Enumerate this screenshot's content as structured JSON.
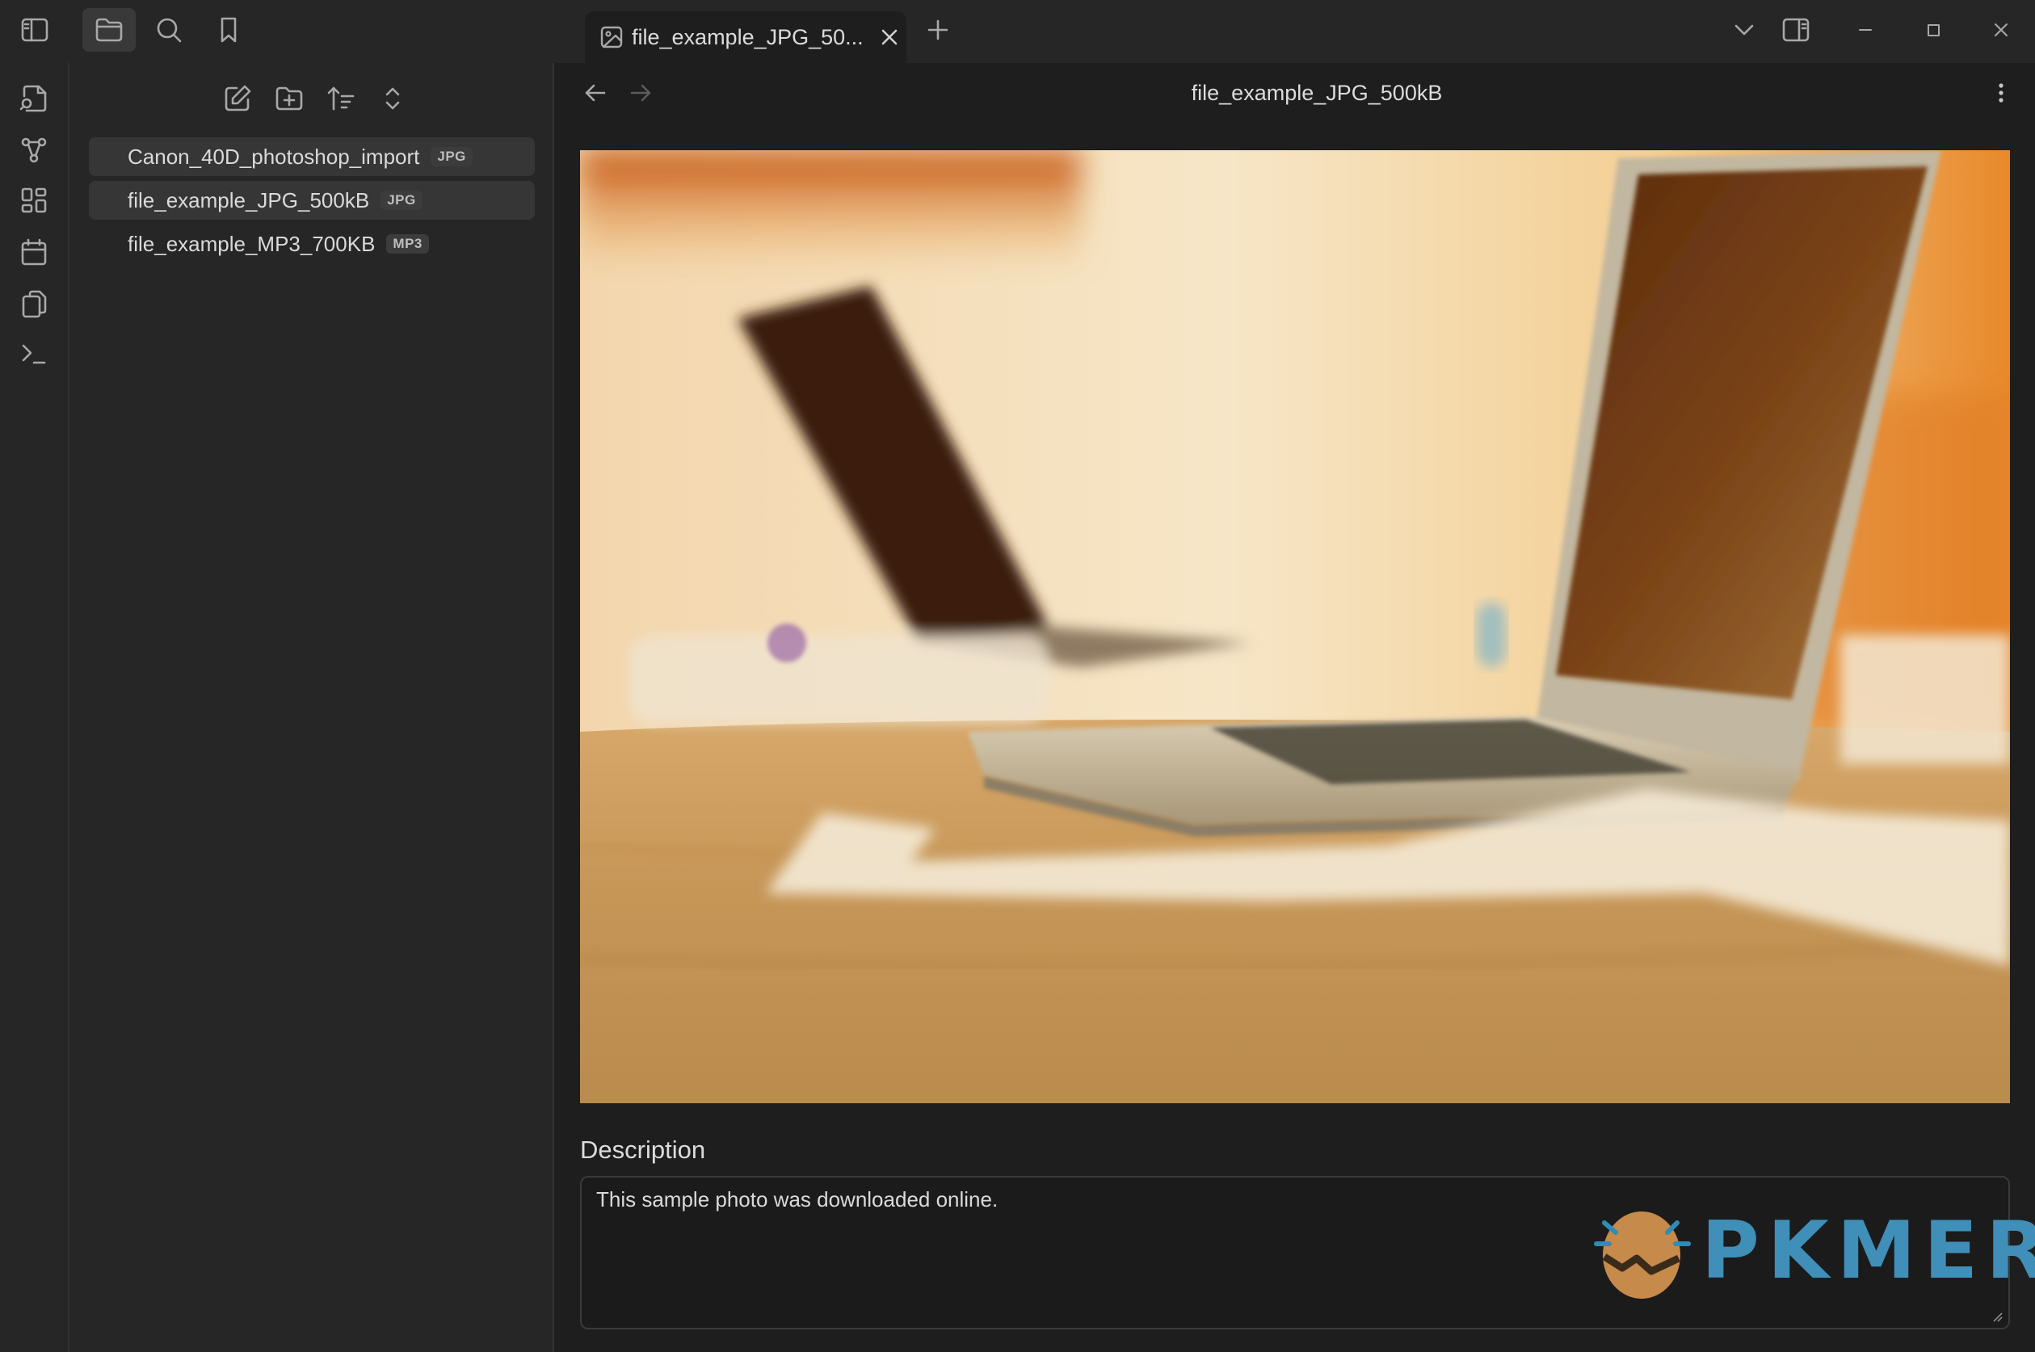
{
  "tab": {
    "title": "file_example_JPG_50...",
    "icon": "image-file-icon"
  },
  "sidebar": {
    "files": [
      {
        "name": "Canon_40D_photoshop_import",
        "ext": "JPG"
      },
      {
        "name": "file_example_JPG_500kB",
        "ext": "JPG"
      },
      {
        "name": "file_example_MP3_700KB",
        "ext": "MP3"
      }
    ]
  },
  "view": {
    "title": "file_example_JPG_500kB"
  },
  "description": {
    "label": "Description",
    "text": "This sample photo was downloaded online."
  },
  "watermark": {
    "text": "PKMER"
  },
  "colors": {
    "background": "#1e1e1e",
    "panel": "#262626",
    "accent": "#3f8fb8"
  }
}
